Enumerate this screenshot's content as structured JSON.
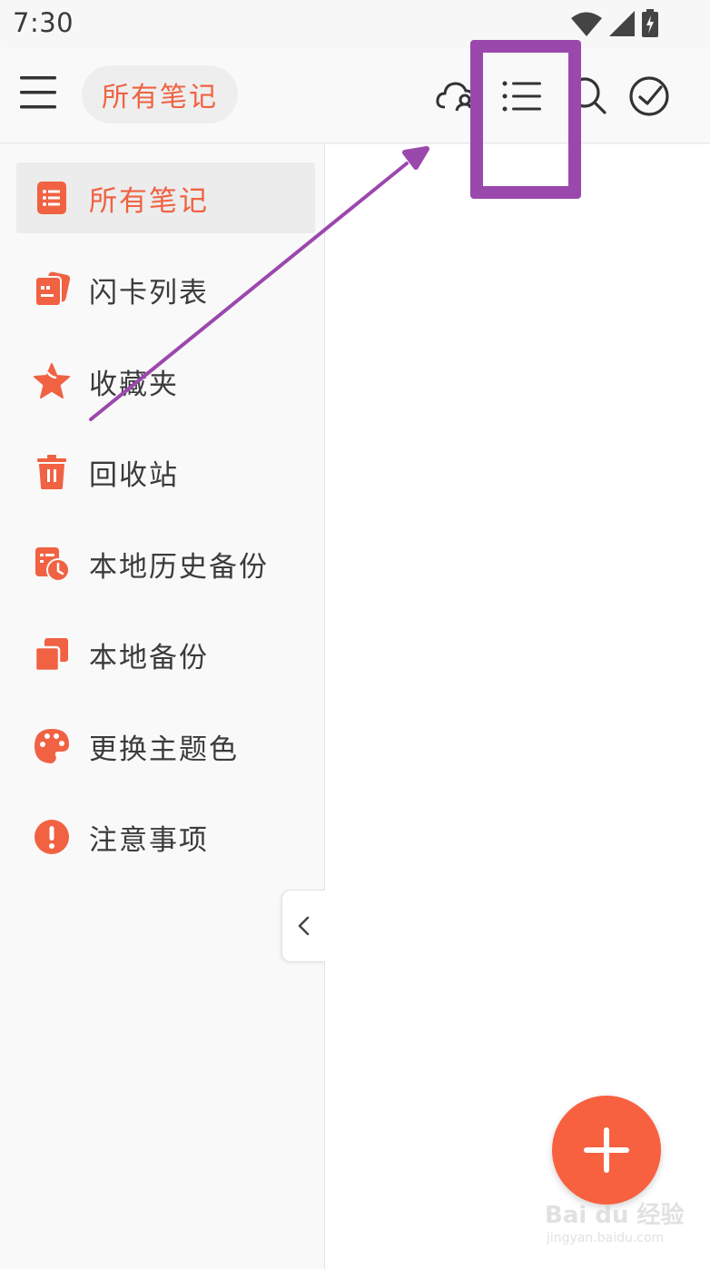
{
  "status_bar": {
    "time": "7:30",
    "icons": [
      "wifi-icon",
      "signal-icon",
      "battery-charging-icon"
    ]
  },
  "toolbar": {
    "menu_icon": "hamburger-menu-icon",
    "title": "所有笔记",
    "actions": [
      "cloud-sync-icon",
      "list-view-icon",
      "search-icon",
      "check-circle-icon"
    ]
  },
  "drawer": {
    "items": [
      {
        "label": "所有笔记",
        "icon": "notes-list-icon",
        "active": true
      },
      {
        "label": "闪卡列表",
        "icon": "flashcards-icon",
        "active": false
      },
      {
        "label": "收藏夹",
        "icon": "star-icon",
        "active": false
      },
      {
        "label": "回收站",
        "icon": "trash-icon",
        "active": false
      },
      {
        "label": "本地历史备份",
        "icon": "history-backup-icon",
        "active": false
      },
      {
        "label": "本地备份",
        "icon": "copy-backup-icon",
        "active": false
      },
      {
        "label": "更换主题色",
        "icon": "palette-icon",
        "active": false
      },
      {
        "label": "注意事项",
        "icon": "exclamation-icon",
        "active": false
      }
    ],
    "collapse_icon": "chevron-left-icon"
  },
  "fab": {
    "icon": "plus-icon"
  },
  "colors": {
    "accent": "#f06242",
    "fab": "#f7613f",
    "annotation": "#9b48ad",
    "drawer_bg": "#f9f9f9",
    "active_bg": "#ececec"
  },
  "watermark": {
    "main": "Bai du 经验",
    "sub": "jingyan.baidu.com"
  }
}
